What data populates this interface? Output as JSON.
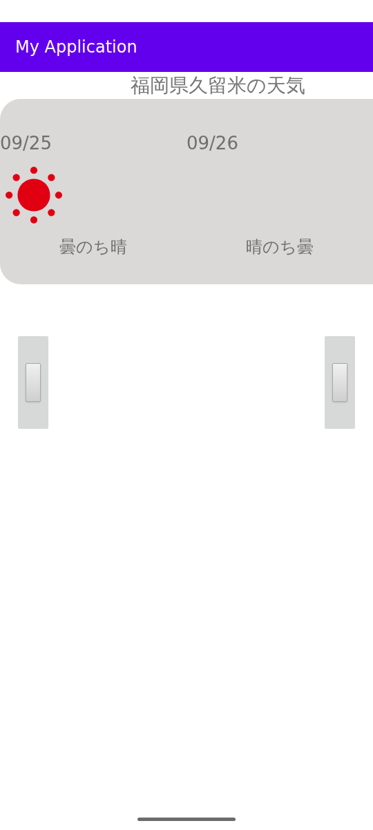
{
  "app_bar": {
    "title": "My Application"
  },
  "heading": "福岡県久留米の天気",
  "days": [
    {
      "date": "09/25",
      "kind": "sunny",
      "weather": "曇のち晴"
    },
    {
      "date": "09/26",
      "kind": "blank",
      "weather": "晴のち曇"
    }
  ],
  "sliders": [
    {
      "level": 0.5
    },
    {
      "level": 0.5
    }
  ]
}
